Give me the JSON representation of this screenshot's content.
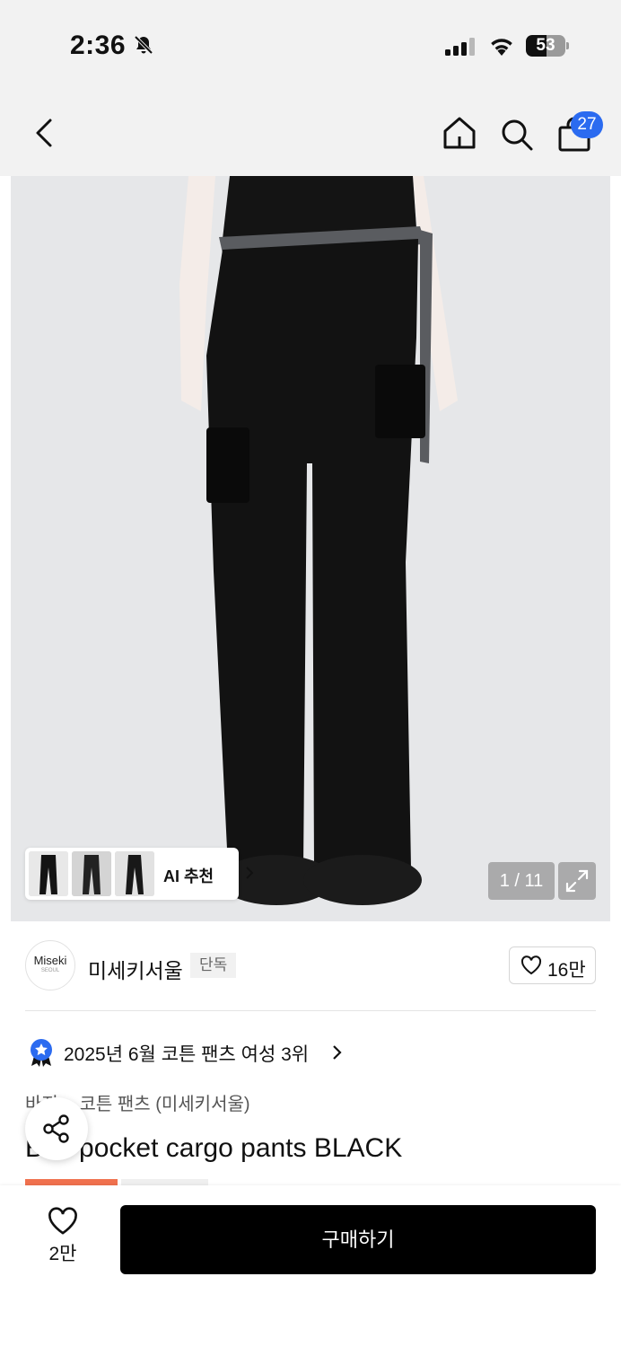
{
  "status_bar": {
    "time": "2:36",
    "battery": "53",
    "battery_level": 0.53
  },
  "nav": {
    "cart_count": "27"
  },
  "gallery": {
    "thumb_label": "AI 추천",
    "counter": "1 / 11"
  },
  "brand": {
    "logo_text": "Miseki",
    "logo_sub": "SEOUL",
    "name": "미세키서울",
    "tag": "단독",
    "likes": "16만"
  },
  "ranking": {
    "text": "2025년 6월 코튼 팬츠 여성 3위"
  },
  "breadcrumb": {
    "level1": "바지",
    "separator": ">",
    "level2": "코튼 팬츠 (미세키서울)"
  },
  "product": {
    "title": "Belt pocket cargo pants BLACK"
  },
  "bottom": {
    "wish_count": "2만",
    "buy_label": "구매하기"
  },
  "colors": {
    "accent_blue": "#2b6bf0",
    "badge_red": "#f0714e",
    "buy_button": "#000000"
  }
}
